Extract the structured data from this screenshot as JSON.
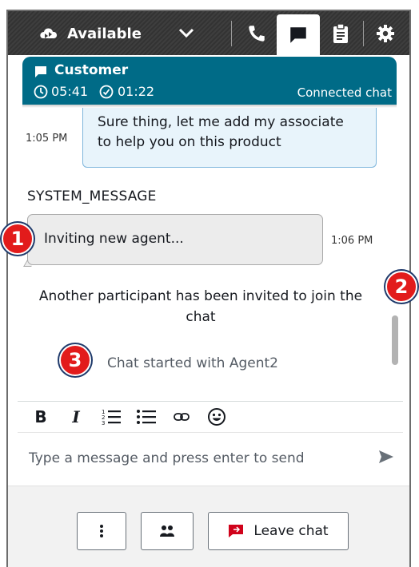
{
  "topbar": {
    "status_label": "Available",
    "icons": [
      "cloud-status-icon",
      "chevron-down-icon",
      "phone-icon",
      "chat-icon",
      "clipboard-icon",
      "gear-icon"
    ]
  },
  "contact": {
    "name": "Customer",
    "timer_total": "05:41",
    "timer_state": "01:22",
    "connection_status": "Connected chat",
    "accent_color": "#006b87"
  },
  "transcript": {
    "customer_message": {
      "time": "1:05 PM",
      "text_line1": "Sure thing, let me add my associate",
      "text_line2": "to help you on this product"
    },
    "system_title": "SYSTEM_MESSAGE",
    "system_message": {
      "text": "Inviting new agent...",
      "time": "1:06 PM"
    },
    "notice_line1": "Another participant has been invited to join the",
    "notice_line2": "chat",
    "started_text": "Chat started with  Agent2"
  },
  "callouts": [
    "1",
    "2",
    "3"
  ],
  "format_toolbar": [
    "bold-icon",
    "italic-icon",
    "numbered-list-icon",
    "bulleted-list-icon",
    "link-icon",
    "emoji-icon"
  ],
  "composer": {
    "placeholder": "Type a message and press enter to send"
  },
  "bottom": {
    "leave_label": "Leave chat",
    "leave_icon_color": "#d0021b"
  }
}
